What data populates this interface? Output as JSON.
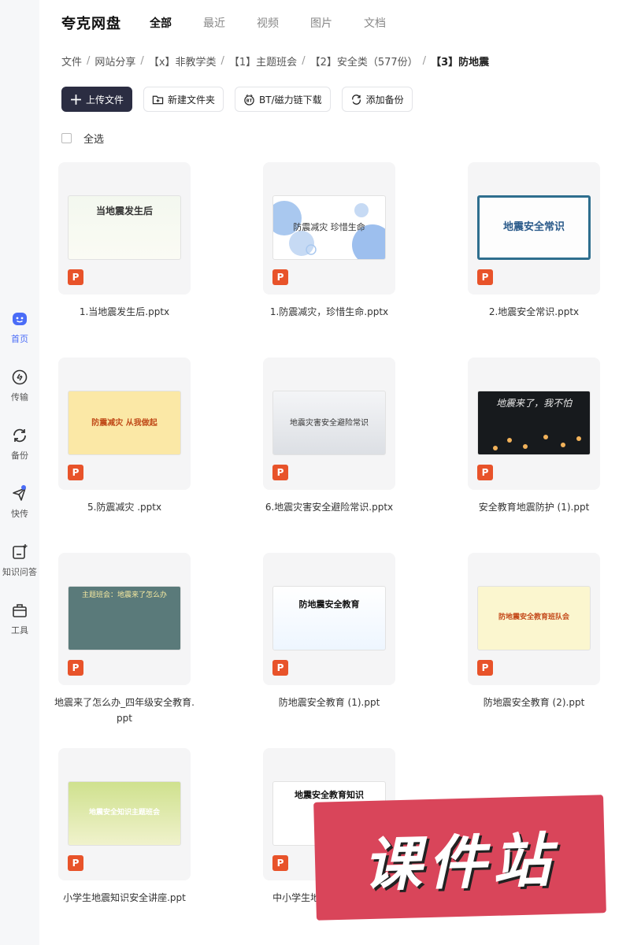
{
  "sidebar": {
    "items": [
      {
        "label": "首页",
        "icon": "home-face-icon",
        "active": true
      },
      {
        "label": "传输",
        "icon": "transfer-icon"
      },
      {
        "label": "备份",
        "icon": "backup-sync-icon"
      },
      {
        "label": "快传",
        "icon": "send-plane-icon",
        "badge_dot": true
      },
      {
        "label": "知识问答",
        "icon": "qa-doc-icon"
      },
      {
        "label": "工具",
        "icon": "toolbox-icon"
      }
    ]
  },
  "header": {
    "brand": "夸克网盘",
    "tabs": [
      "全部",
      "最近",
      "视频",
      "图片",
      "文档"
    ],
    "active_tab": "全部"
  },
  "breadcrumb": [
    "文件",
    "网站分享",
    "【x】非教学类",
    "【1】主题班会",
    "【2】安全类（577份）",
    "【3】防地震"
  ],
  "toolbar": {
    "upload": "上传文件",
    "new_folder": "新建文件夹",
    "bt_download": "BT/磁力链下载",
    "add_backup": "添加备份"
  },
  "select_all": "全选",
  "file_type_icon_label": "P",
  "files": [
    {
      "name": "1.当地震发生后.pptx",
      "thumb_text": "当地震发生后"
    },
    {
      "name": "1.防震减灾，珍惜生命.pptx",
      "thumb_text": "防震减灾 珍惜生命"
    },
    {
      "name": "2.地震安全常识.pptx",
      "thumb_text": "地震安全常识"
    },
    {
      "name": "5.防震减灾 .pptx",
      "thumb_text": "防震减灾 从我做起"
    },
    {
      "name": "6.地震灾害安全避险常识.pptx",
      "thumb_text": "地震灾害安全避险常识"
    },
    {
      "name": "安全教育地震防护 (1).ppt",
      "thumb_text": "地震来了，我不怕"
    },
    {
      "name": "地震来了怎么办_四年级安全教育.ppt",
      "thumb_text": "主题班会：地震来了怎么办"
    },
    {
      "name": "防地震安全教育 (1).ppt",
      "thumb_text": "防地震安全教育"
    },
    {
      "name": "防地震安全教育 (2).ppt",
      "thumb_text": "防地震安全教育班队会"
    },
    {
      "name": "小学生地震知识安全讲座.ppt",
      "thumb_text": "地震安全知识主题班会"
    },
    {
      "name": "中小学生地震安全知识.ppt",
      "thumb_text": "地震安全教育知识"
    }
  ],
  "watermark": "课件站",
  "colors": {
    "accent": "#4a6cf7",
    "primary_button": "#2b2d42",
    "ppt_icon": "#e8532a",
    "watermark": "#d9455a"
  }
}
